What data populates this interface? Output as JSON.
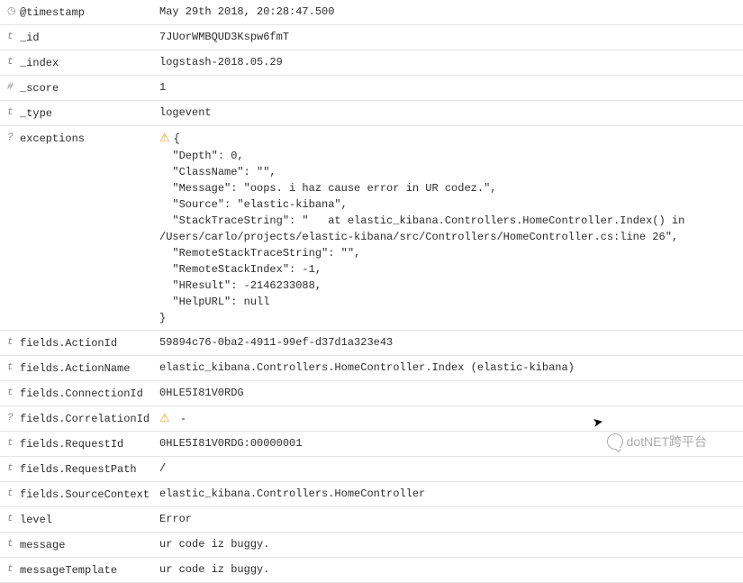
{
  "rows": [
    {
      "type": "clock",
      "key": "@timestamp",
      "value": "May 29th 2018, 20:28:47.500"
    },
    {
      "type": "t",
      "key": "_id",
      "value": "7JUorWMBQUD3Kspw6fmT"
    },
    {
      "type": "t",
      "key": "_index",
      "value": "logstash-2018.05.29"
    },
    {
      "type": "#",
      "key": "_score",
      "value": "1"
    },
    {
      "type": "t",
      "key": "_type",
      "value": "logevent"
    },
    {
      "type": "?",
      "key": "exceptions",
      "warn": true,
      "value": "{\n  \"Depth\": 0,\n  \"ClassName\": \"\",\n  \"Message\": \"oops. i haz cause error in UR codez.\",\n  \"Source\": \"elastic-kibana\",\n  \"StackTraceString\": \"   at elastic_kibana.Controllers.HomeController.Index() in /Users/carlo/projects/elastic-kibana/src/Controllers/HomeController.cs:line 26\",\n  \"RemoteStackTraceString\": \"\",\n  \"RemoteStackIndex\": -1,\n  \"HResult\": -2146233088,\n  \"HelpURL\": null\n}"
    },
    {
      "type": "t",
      "key": "fields.ActionId",
      "value": "59894c76-0ba2-4911-99ef-d37d1a323e43"
    },
    {
      "type": "t",
      "key": "fields.ActionName",
      "value": "elastic_kibana.Controllers.HomeController.Index (elastic-kibana)"
    },
    {
      "type": "t",
      "key": "fields.ConnectionId",
      "value": "0HLE5I81V0RDG"
    },
    {
      "type": "?",
      "key": "fields.CorrelationId",
      "warn": true,
      "value": " -"
    },
    {
      "type": "t",
      "key": "fields.RequestId",
      "value": "0HLE5I81V0RDG:00000001"
    },
    {
      "type": "t",
      "key": "fields.RequestPath",
      "value": "/"
    },
    {
      "type": "t",
      "key": "fields.SourceContext",
      "value": "elastic_kibana.Controllers.HomeController"
    },
    {
      "type": "t",
      "key": "level",
      "value": "Error"
    },
    {
      "type": "t",
      "key": "message",
      "value": "ur code iz buggy."
    },
    {
      "type": "t",
      "key": "messageTemplate",
      "value": "ur code iz buggy."
    }
  ],
  "watermark": "dotNET跨平台",
  "typeGlyphs": {
    "clock": "◷",
    "t": "t",
    "#": "#",
    "?": "?"
  }
}
